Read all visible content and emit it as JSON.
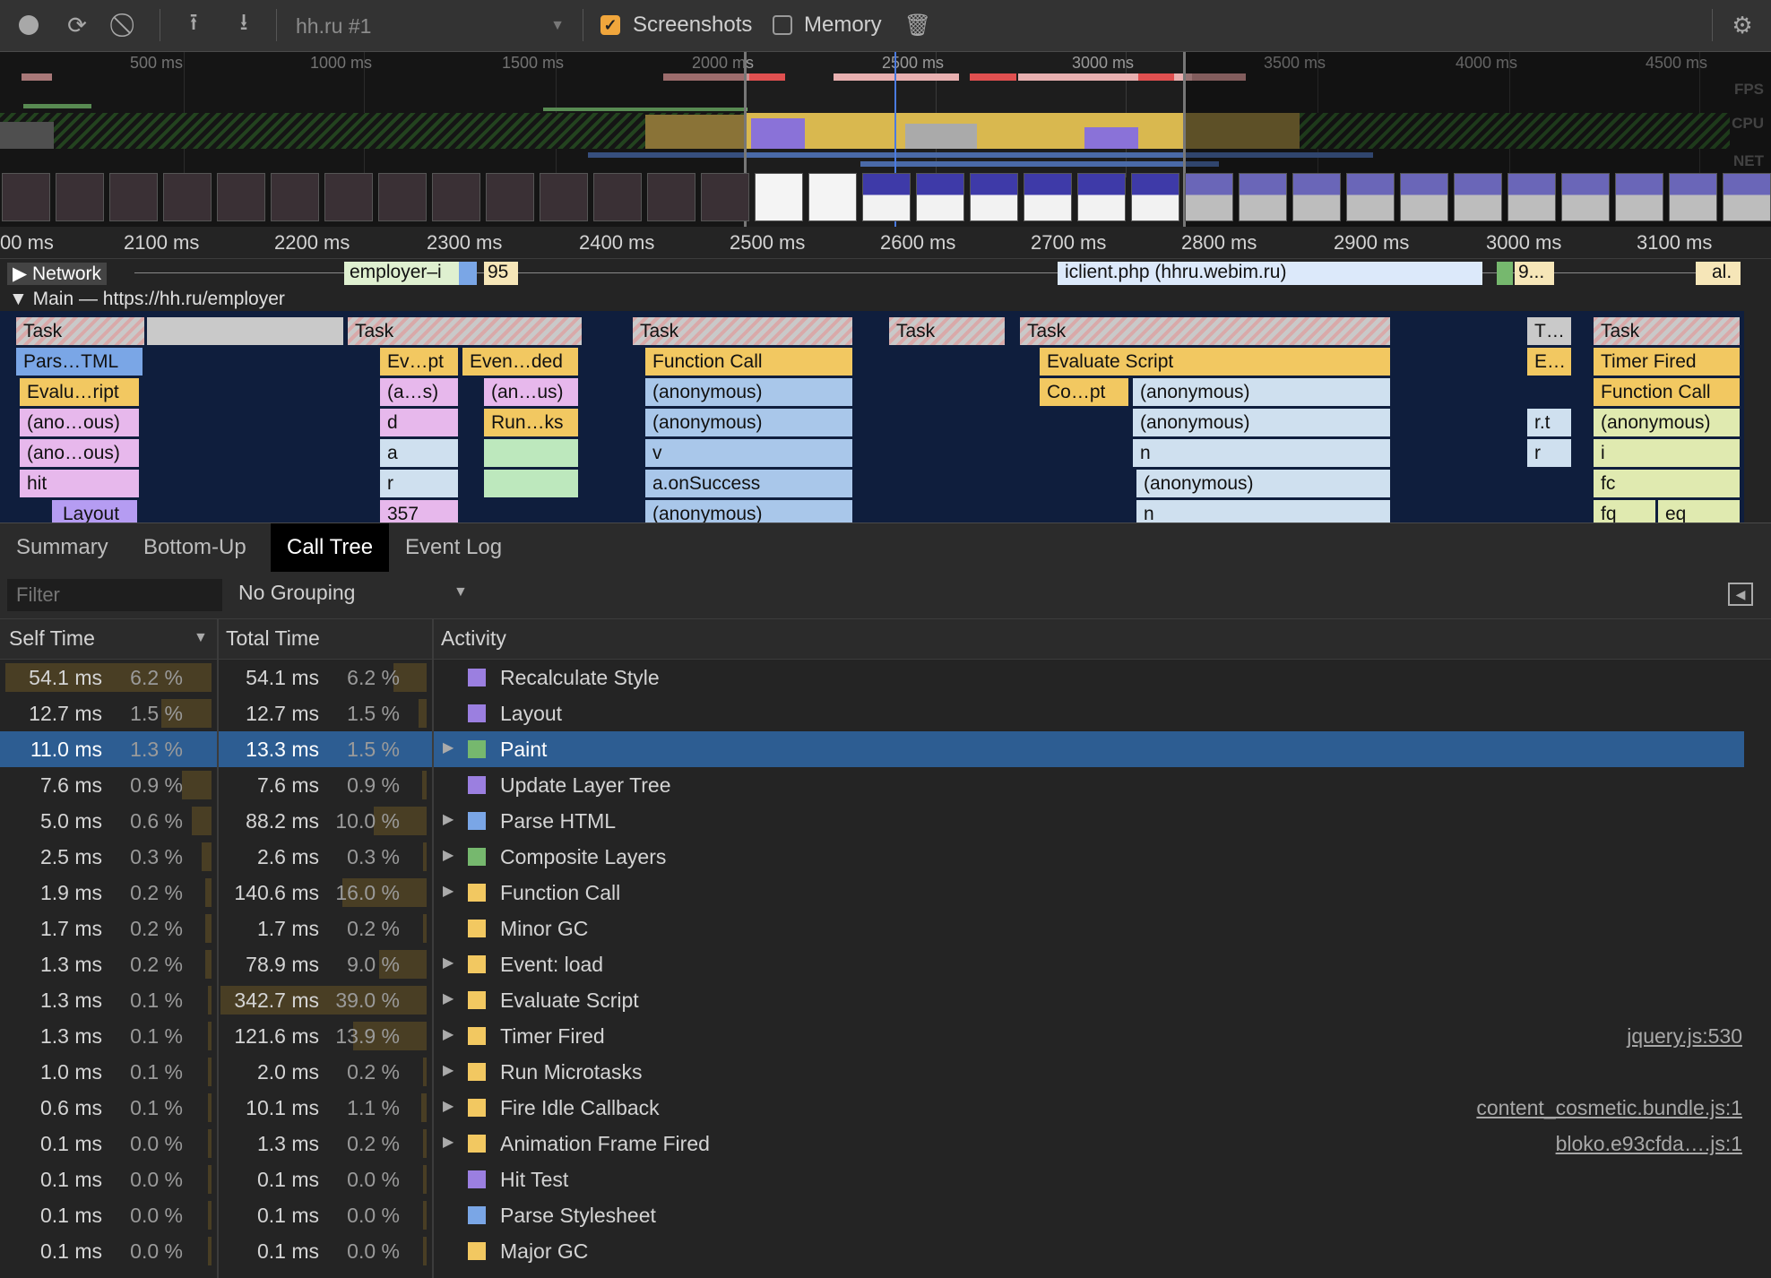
{
  "toolbar": {
    "profile": "hh.ru #1",
    "screenshots_label": "Screenshots",
    "memory_label": "Memory",
    "screenshots_checked": true,
    "memory_checked": false
  },
  "overview": {
    "ticks": [
      "500 ms",
      "1000 ms",
      "1500 ms",
      "2000 ms",
      "2500 ms",
      "3000 ms",
      "3500 ms",
      "4000 ms",
      "4500 ms"
    ],
    "row_labels": {
      "fps": "FPS",
      "cpu": "CPU",
      "net": "NET"
    }
  },
  "ruler": {
    "ticks": [
      "00 ms",
      "2100 ms",
      "2200 ms",
      "2300 ms",
      "2400 ms",
      "2500 ms",
      "2600 ms",
      "2700 ms",
      "2800 ms",
      "2900 ms",
      "3000 ms",
      "3100 ms"
    ]
  },
  "tracks": {
    "network": "Network",
    "main": "Main — https://hh.ru/employer",
    "network_items": [
      "employer–i",
      "95",
      "iclient.php (hhru.webim.ru)",
      "9...",
      "al."
    ]
  },
  "flame": {
    "task": "Task",
    "t_short": "T…",
    "labels": {
      "parse_html": "Pars…TML",
      "evaluate_script_short": "Evalu…ript",
      "ano_1": "(ano…ous)",
      "ano_2": "(ano…ous)",
      "hit": "hit",
      "layout": "Layout",
      "ev_pt": "Ev…pt",
      "a_s": "(a…s)",
      "d": "d",
      "a": "a",
      "r": "r",
      "n357": "357",
      "even_ded": "Even…ded",
      "an_us": "(an…us)",
      "run_ks": "Run…ks",
      "function_call": "Function Call",
      "anonymous": "(anonymous)",
      "v": "v",
      "a_onsuccess": "a.onSuccess",
      "evaluate_script": "Evaluate Script",
      "co_pt": "Co…pt",
      "n": "n",
      "e_short": "E…",
      "r_t": "r.t",
      "timer_fired": "Timer Fired",
      "i": "i",
      "fc": "fc",
      "fq": "fq",
      "eq": "eq"
    }
  },
  "tabs": [
    "Summary",
    "Bottom-Up",
    "Call Tree",
    "Event Log"
  ],
  "active_tab": "Call Tree",
  "filter": {
    "placeholder": "Filter",
    "grouping": "No Grouping"
  },
  "columns": {
    "self": "Self Time",
    "total": "Total Time",
    "activity": "Activity"
  },
  "colors": {
    "purple": "#9b7fe0",
    "blue": "#7aa6e6",
    "green": "#76b86e",
    "yellow": "#f2c861"
  },
  "rows": [
    {
      "self": "54.1 ms",
      "self_pct": "6.2 %",
      "total": "54.1 ms",
      "total_pct": "6.2 %",
      "activity": "Recalculate Style",
      "color": "#9b7fe0",
      "expand": false,
      "link": ""
    },
    {
      "self": "12.7 ms",
      "self_pct": "1.5 %",
      "total": "12.7 ms",
      "total_pct": "1.5 %",
      "activity": "Layout",
      "color": "#9b7fe0",
      "expand": false,
      "link": ""
    },
    {
      "self": "11.0 ms",
      "self_pct": "1.3 %",
      "total": "13.3 ms",
      "total_pct": "1.5 %",
      "activity": "Paint",
      "color": "#76b86e",
      "expand": true,
      "link": "",
      "selected": true
    },
    {
      "self": "7.6 ms",
      "self_pct": "0.9 %",
      "total": "7.6 ms",
      "total_pct": "0.9 %",
      "activity": "Update Layer Tree",
      "color": "#9b7fe0",
      "expand": false,
      "link": ""
    },
    {
      "self": "5.0 ms",
      "self_pct": "0.6 %",
      "total": "88.2 ms",
      "total_pct": "10.0 %",
      "activity": "Parse HTML",
      "color": "#7aa6e6",
      "expand": true,
      "link": ""
    },
    {
      "self": "2.5 ms",
      "self_pct": "0.3 %",
      "total": "2.6 ms",
      "total_pct": "0.3 %",
      "activity": "Composite Layers",
      "color": "#76b86e",
      "expand": true,
      "link": ""
    },
    {
      "self": "1.9 ms",
      "self_pct": "0.2 %",
      "total": "140.6 ms",
      "total_pct": "16.0 %",
      "activity": "Function Call",
      "color": "#f2c861",
      "expand": true,
      "link": ""
    },
    {
      "self": "1.7 ms",
      "self_pct": "0.2 %",
      "total": "1.7 ms",
      "total_pct": "0.2 %",
      "activity": "Minor GC",
      "color": "#f2c861",
      "expand": false,
      "link": ""
    },
    {
      "self": "1.3 ms",
      "self_pct": "0.2 %",
      "total": "78.9 ms",
      "total_pct": "9.0 %",
      "activity": "Event: load",
      "color": "#f2c861",
      "expand": true,
      "link": ""
    },
    {
      "self": "1.3 ms",
      "self_pct": "0.1 %",
      "total": "342.7 ms",
      "total_pct": "39.0 %",
      "activity": "Evaluate Script",
      "color": "#f2c861",
      "expand": true,
      "link": ""
    },
    {
      "self": "1.3 ms",
      "self_pct": "0.1 %",
      "total": "121.6 ms",
      "total_pct": "13.9 %",
      "activity": "Timer Fired",
      "color": "#f2c861",
      "expand": true,
      "link": "jquery.js:530"
    },
    {
      "self": "1.0 ms",
      "self_pct": "0.1 %",
      "total": "2.0 ms",
      "total_pct": "0.2 %",
      "activity": "Run Microtasks",
      "color": "#f2c861",
      "expand": true,
      "link": ""
    },
    {
      "self": "0.6 ms",
      "self_pct": "0.1 %",
      "total": "10.1 ms",
      "total_pct": "1.1 %",
      "activity": "Fire Idle Callback",
      "color": "#f2c861",
      "expand": true,
      "link": "content_cosmetic.bundle.js:1"
    },
    {
      "self": "0.1 ms",
      "self_pct": "0.0 %",
      "total": "1.3 ms",
      "total_pct": "0.2 %",
      "activity": "Animation Frame Fired",
      "color": "#f2c861",
      "expand": true,
      "link": "bloko.e93cfda….js:1"
    },
    {
      "self": "0.1 ms",
      "self_pct": "0.0 %",
      "total": "0.1 ms",
      "total_pct": "0.0 %",
      "activity": "Hit Test",
      "color": "#9b7fe0",
      "expand": false,
      "link": ""
    },
    {
      "self": "0.1 ms",
      "self_pct": "0.0 %",
      "total": "0.1 ms",
      "total_pct": "0.0 %",
      "activity": "Parse Stylesheet",
      "color": "#7aa6e6",
      "expand": false,
      "link": ""
    },
    {
      "self": "0.1 ms",
      "self_pct": "0.0 %",
      "total": "0.1 ms",
      "total_pct": "0.0 %",
      "activity": "Major GC",
      "color": "#f2c861",
      "expand": false,
      "link": ""
    }
  ]
}
